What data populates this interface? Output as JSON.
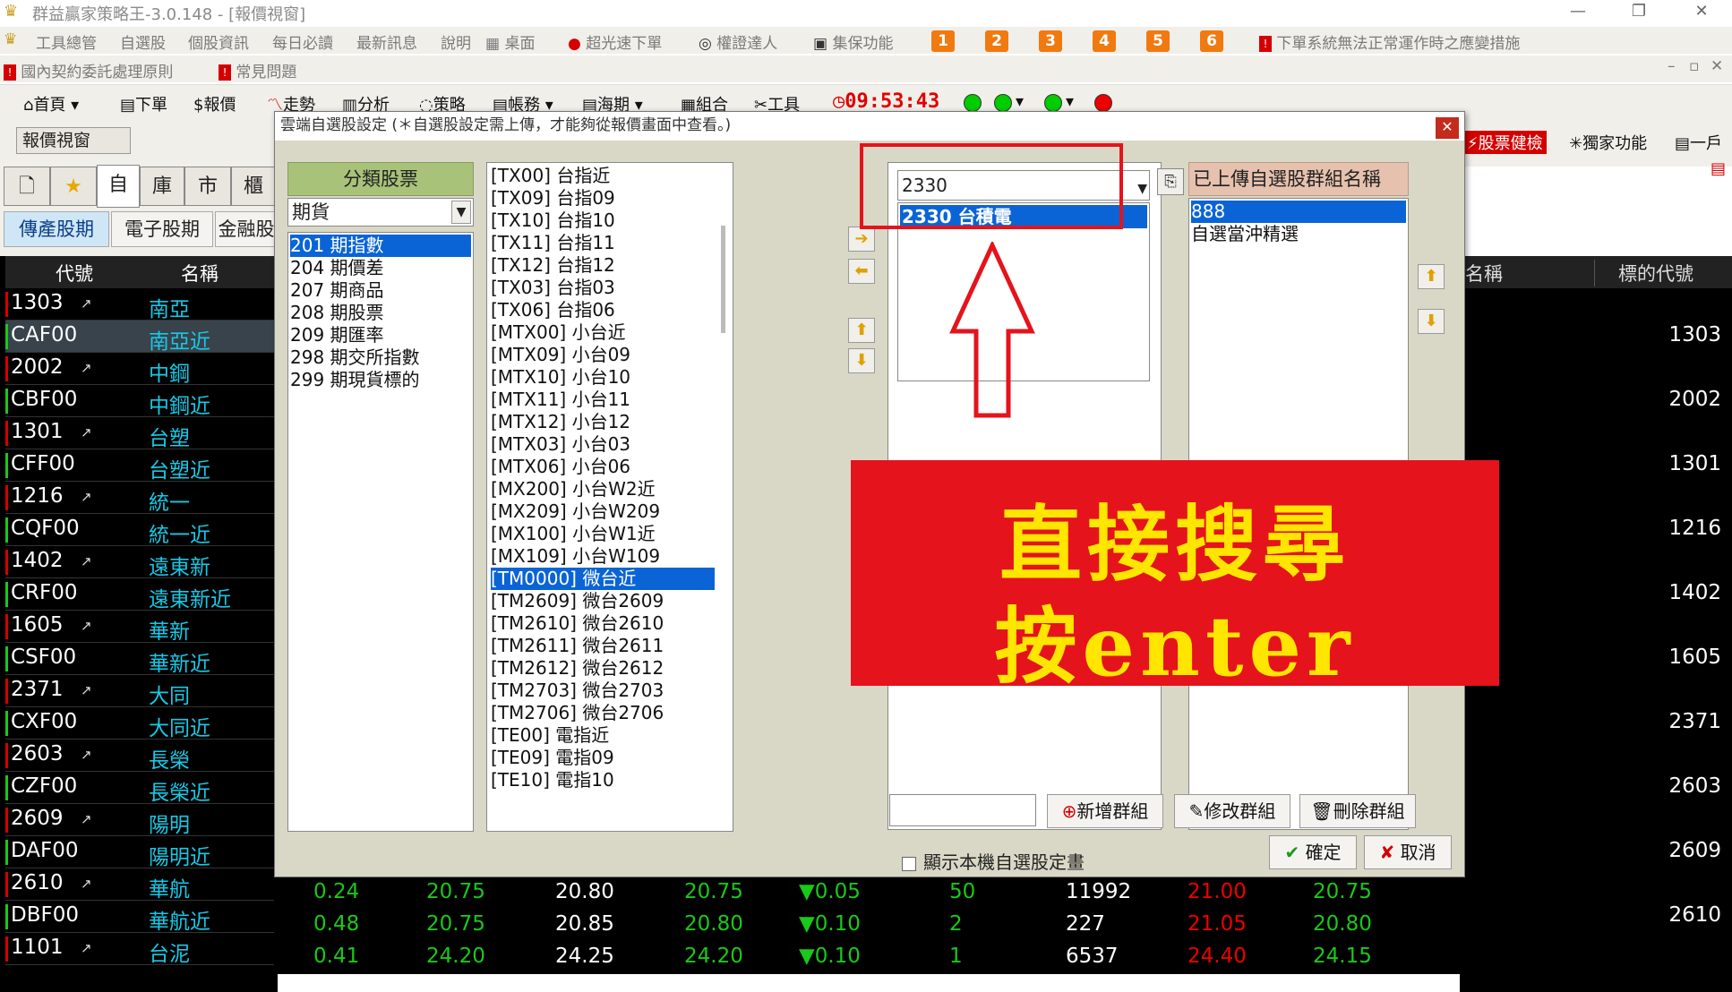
{
  "window": {
    "title": "群益贏家策略王-3.0.148 - [報價視窗]"
  },
  "menu1": [
    "工具總管",
    "自選股",
    "個股資訊",
    "每日必讀",
    "最新訊息",
    "說明",
    "桌面",
    "超光速下單",
    "權證達人",
    "集保功能",
    "1",
    "2",
    "3",
    "4",
    "5",
    "6",
    "下單系統無法正常運作時之應變措施"
  ],
  "menu2": [
    "國內契約委託處理原則",
    "常見問題"
  ],
  "toolbar": {
    "items": [
      "首頁",
      "下單",
      "報價",
      "走勢",
      "分析",
      "策略",
      "帳務",
      "海期",
      "組合",
      "工具"
    ],
    "clock": "09:53:43"
  },
  "report_tab": "報價視窗",
  "right_tools": [
    "股票健檢",
    "獨家功能",
    "一戶"
  ],
  "left_tabs": {
    "icons": [
      "自",
      "庫",
      "市",
      "櫃"
    ],
    "cats": [
      "傳產股期",
      "電子股期",
      "金融股"
    ]
  },
  "quote_headers": {
    "code": "代號",
    "name": "名稱"
  },
  "quote_rows": [
    {
      "code": "1303",
      "name": "南亞",
      "stock": true
    },
    {
      "code": "CAF00",
      "name": "南亞近",
      "stock": false
    },
    {
      "code": "2002",
      "name": "中鋼",
      "stock": true
    },
    {
      "code": "CBF00",
      "name": "中鋼近",
      "stock": false
    },
    {
      "code": "1301",
      "name": "台塑",
      "stock": true
    },
    {
      "code": "CFF00",
      "name": "台塑近",
      "stock": false
    },
    {
      "code": "1216",
      "name": "統一",
      "stock": true
    },
    {
      "code": "CQF00",
      "name": "統一近",
      "stock": false
    },
    {
      "code": "1402",
      "name": "遠東新",
      "stock": true
    },
    {
      "code": "CRF00",
      "name": "遠東新近",
      "stock": false
    },
    {
      "code": "1605",
      "name": "華新",
      "stock": true
    },
    {
      "code": "CSF00",
      "name": "華新近",
      "stock": false
    },
    {
      "code": "2371",
      "name": "大同",
      "stock": true
    },
    {
      "code": "CXF00",
      "name": "大同近",
      "stock": false
    },
    {
      "code": "2603",
      "name": "長榮",
      "stock": true
    },
    {
      "code": "CZF00",
      "name": "長榮近",
      "stock": false
    },
    {
      "code": "2609",
      "name": "陽明",
      "stock": true
    },
    {
      "code": "DAF00",
      "name": "陽明近",
      "stock": false
    },
    {
      "code": "2610",
      "name": "華航",
      "stock": true
    },
    {
      "code": "DBF00",
      "name": "華航近",
      "stock": false
    },
    {
      "code": "1101",
      "name": "台泥",
      "stock": true
    }
  ],
  "right_headers": {
    "name": "名稱",
    "underlying": "標的代號"
  },
  "right_codes": [
    "1303",
    "2002",
    "1301",
    "1216",
    "1402",
    "1605",
    "2371",
    "2603",
    "2609",
    "2610"
  ],
  "bottom_rows": [
    {
      "a": "0.24",
      "b": "20.75",
      "c": "20.80",
      "d": "20.75",
      "chg": "▼0.05",
      "vol": "50",
      "tot": "11992",
      "hi": "21.00",
      "lo": "20.75"
    },
    {
      "a": "0.48",
      "b": "20.75",
      "c": "20.85",
      "d": "20.80",
      "chg": "▼0.10",
      "vol": "2",
      "tot": "227",
      "hi": "21.05",
      "lo": "20.80"
    },
    {
      "a": "0.41",
      "b": "24.20",
      "c": "24.25",
      "d": "24.20",
      "chg": "▼0.10",
      "vol": "1",
      "tot": "6537",
      "hi": "24.40",
      "lo": "24.15"
    }
  ],
  "dialog": {
    "title": "雲端自選股設定 (＊自選股設定需上傳，才能夠從報價畫面中查看。)",
    "category_header": "分類股票",
    "category_select": "期貨",
    "categories": [
      "201 期指數",
      "204 期價差",
      "207 期商品",
      "208 期股票",
      "209 期匯率",
      "298 期交所指數",
      "299 期現貨標的"
    ],
    "products": [
      "[TX00] 台指近",
      "[TX09] 台指09",
      "[TX10] 台指10",
      "[TX11] 台指11",
      "[TX12] 台指12",
      "[TX03] 台指03",
      "[TX06] 台指06",
      "[MTX00] 小台近",
      "[MTX09] 小台09",
      "[MTX10] 小台10",
      "[MTX11] 小台11",
      "[MTX12] 小台12",
      "[MTX03] 小台03",
      "[MTX06] 小台06",
      "[MX200] 小台W2近",
      "[MX209] 小台W209",
      "[MX100] 小台W1近",
      "[MX109] 小台W109",
      "[TM0000] 微台近",
      "[TM2609] 微台2609",
      "[TM2610] 微台2610",
      "[TM2611] 微台2611",
      "[TM2612] 微台2612",
      "[TM2703] 微台2703",
      "[TM2706] 微台2706",
      "[TE00] 電指近",
      "[TE09] 電指09",
      "[TE10] 電指10"
    ],
    "search_value": "2330",
    "search_result": "2330 台積電",
    "group_header": "已上傳自選股群組名稱",
    "groups": [
      "888",
      "自選當沖精選"
    ],
    "btn_add_group": "新增群組",
    "btn_edit_group": "修改群組",
    "btn_delete_group": "刪除群組",
    "show_local": "顯示本機自選股定畫",
    "ok": "確定",
    "cancel": "取消"
  },
  "annotation": {
    "line1": "直接搜尋",
    "line2": "按enter"
  },
  "colors": {
    "accent_red": "#e5131c",
    "annotation_text": "#ffe600",
    "selection_blue": "#0a64d6"
  }
}
